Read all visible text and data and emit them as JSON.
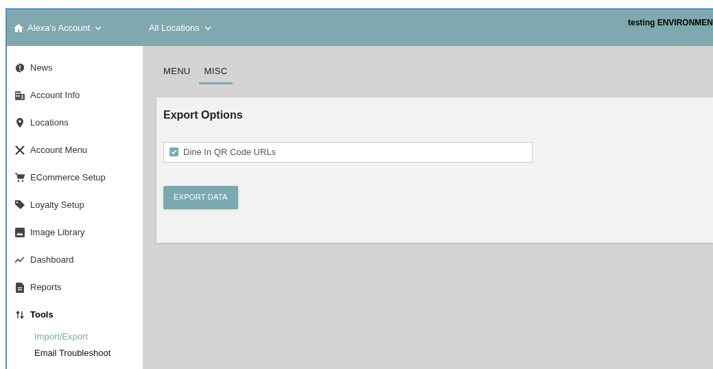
{
  "header": {
    "account": "Alexa's Account",
    "location": "All Locations",
    "environment": "testing ENVIRONMEN"
  },
  "sidebar": {
    "items": [
      {
        "label": "News",
        "expanded": false
      },
      {
        "label": "Account Info",
        "expanded": false
      },
      {
        "label": "Locations",
        "expanded": false
      },
      {
        "label": "Account Menu",
        "expanded": false
      },
      {
        "label": "ECommerce Setup",
        "expanded": false
      },
      {
        "label": "Loyalty Setup",
        "expanded": false
      },
      {
        "label": "Image Library",
        "expanded": false
      },
      {
        "label": "Dashboard",
        "expanded": false
      },
      {
        "label": "Reports",
        "expanded": false
      },
      {
        "label": "Tools",
        "expanded": true,
        "children": [
          {
            "label": "Import/Export",
            "selected": true
          },
          {
            "label": "Email Troubleshoot",
            "selected": false
          }
        ]
      }
    ]
  },
  "tabs": [
    {
      "label": "MENU",
      "selected": false
    },
    {
      "label": "MISC",
      "selected": true
    }
  ],
  "card": {
    "title": "Export Options",
    "options": [
      {
        "label": "Dine In QR Code URLs",
        "checked": true
      }
    ],
    "button": "EXPORT DATA"
  }
}
